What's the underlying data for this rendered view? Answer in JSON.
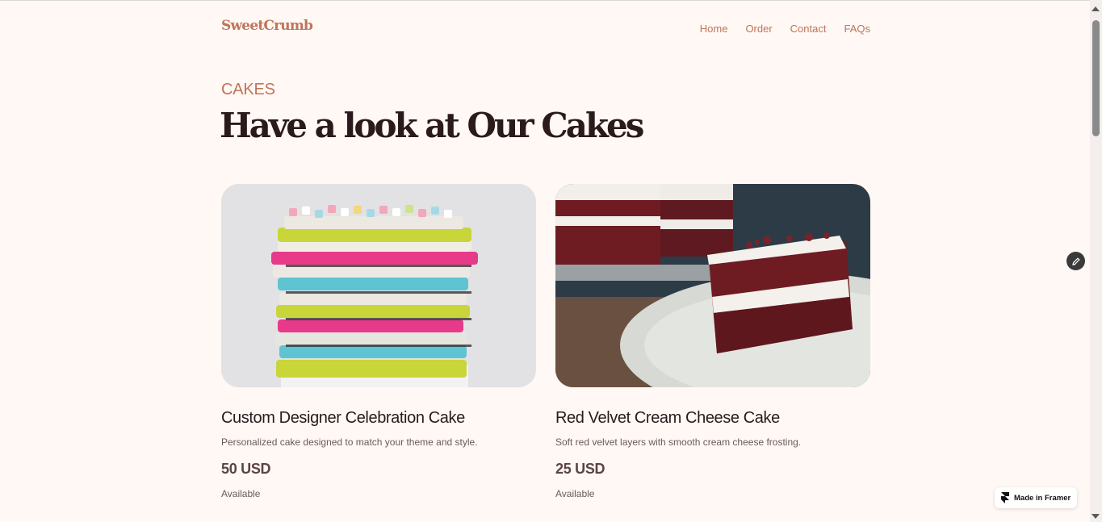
{
  "brand": {
    "name": "SweetCrumb",
    "accent": "#c0745a",
    "ink": "#2a1a1c"
  },
  "nav": {
    "items": [
      "Home",
      "Order",
      "Contact",
      "FAQs"
    ]
  },
  "section": {
    "eyebrow": "CAKES",
    "title": "Have a look at Our Cakes"
  },
  "products": [
    {
      "name": "Custom Designer Celebration Cake",
      "description": "Personalized cake designed to match your theme and style.",
      "price": "50 USD",
      "status": "Available"
    },
    {
      "name": "Red Velvet Cream Cheese Cake",
      "description": "Soft red velvet layers with smooth cream cheese frosting.",
      "price": "25 USD",
      "status": "Available"
    }
  ],
  "badge": {
    "label": "Made in Framer",
    "icon": "framer-logo-icon"
  },
  "edit_button": {
    "icon": "pencil-icon"
  }
}
